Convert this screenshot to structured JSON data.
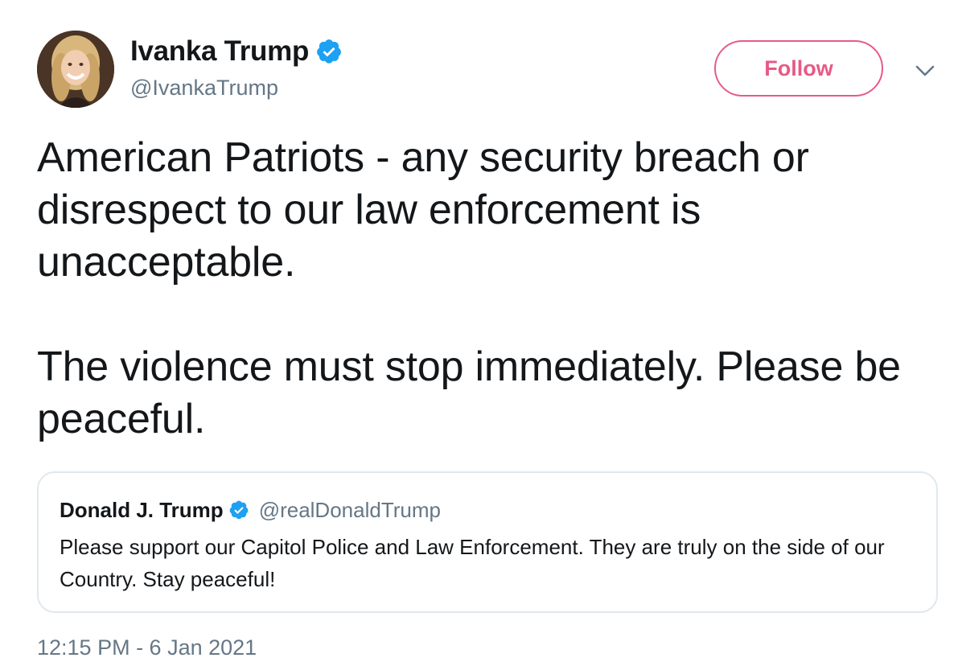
{
  "author": {
    "display_name": "Ivanka Trump",
    "handle": "@IvankaTrump",
    "verified": true
  },
  "follow_label": "Follow",
  "colors": {
    "follow_accent": "#e0245e",
    "verified_blue": "#1da1f2",
    "secondary_text": "#657786",
    "border": "#e1e8ed"
  },
  "tweet": {
    "paragraphs": [
      "American Patriots - any security breach or disrespect to our law enforcement is unacceptable.",
      "The violence must stop immediately. Please be peaceful."
    ],
    "timestamp": "12:15 PM - 6 Jan 2021"
  },
  "quoted_tweet": {
    "display_name": "Donald J. Trump",
    "handle": "@realDonaldTrump",
    "verified": true,
    "text": "Please support our Capitol Police and Law Enforcement. They are truly on the side of our Country. Stay peaceful!"
  },
  "icons": {
    "verified": "verified-badge-icon",
    "menu": "chevron-down-icon",
    "avatar": "profile-avatar"
  }
}
